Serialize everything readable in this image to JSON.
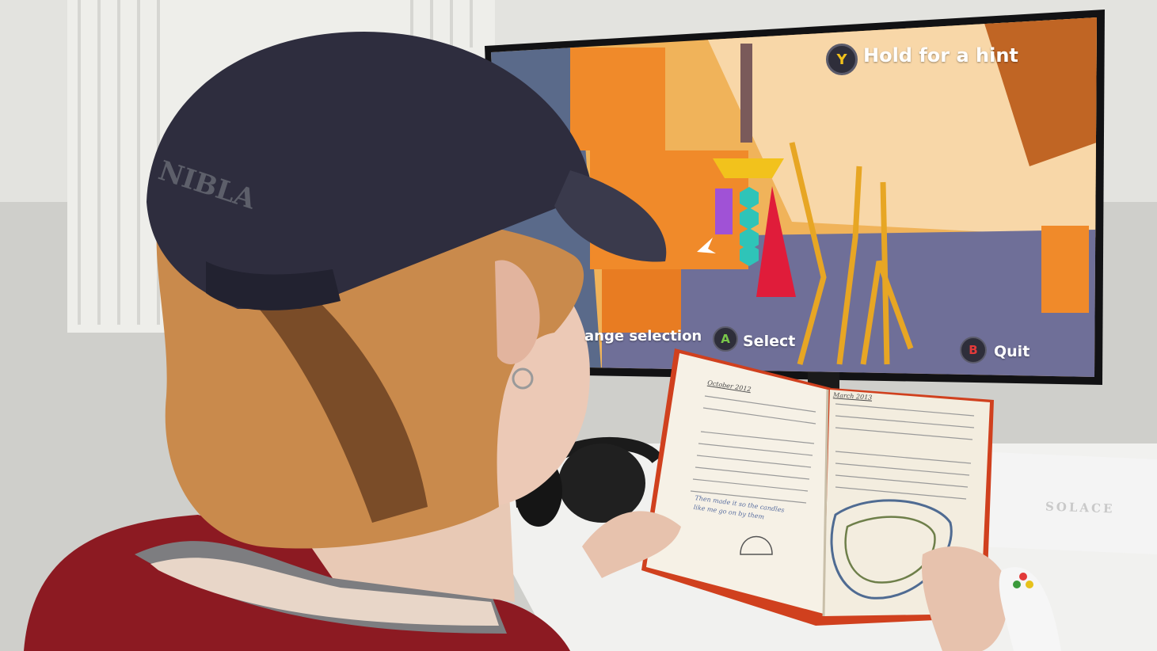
{
  "game_hud": {
    "hint_button": "Y",
    "hint_label": "Hold for a hint",
    "change_selection_label": "ange selection",
    "select_button": "A",
    "select_label": "Select",
    "quit_button": "B",
    "quit_label": "Quit"
  },
  "journal": {
    "left_heading": "October 2012",
    "right_heading": "March 2013",
    "left_caption": "Then made it so the candles like me go on by them"
  },
  "cap_text": "NIBLA",
  "box_text": "SOLACE",
  "colors": {
    "screen_bg": "#f0b35a",
    "orange_block": "#f08a2a",
    "teal_hex": "#2fc4b8",
    "purple_bar": "#a052d6",
    "red_cone": "#e01c3a",
    "cap": "#2e2d3e",
    "hair": "#c98a4c",
    "shirt": "#8c1a22",
    "book_cover": "#d0401e"
  }
}
